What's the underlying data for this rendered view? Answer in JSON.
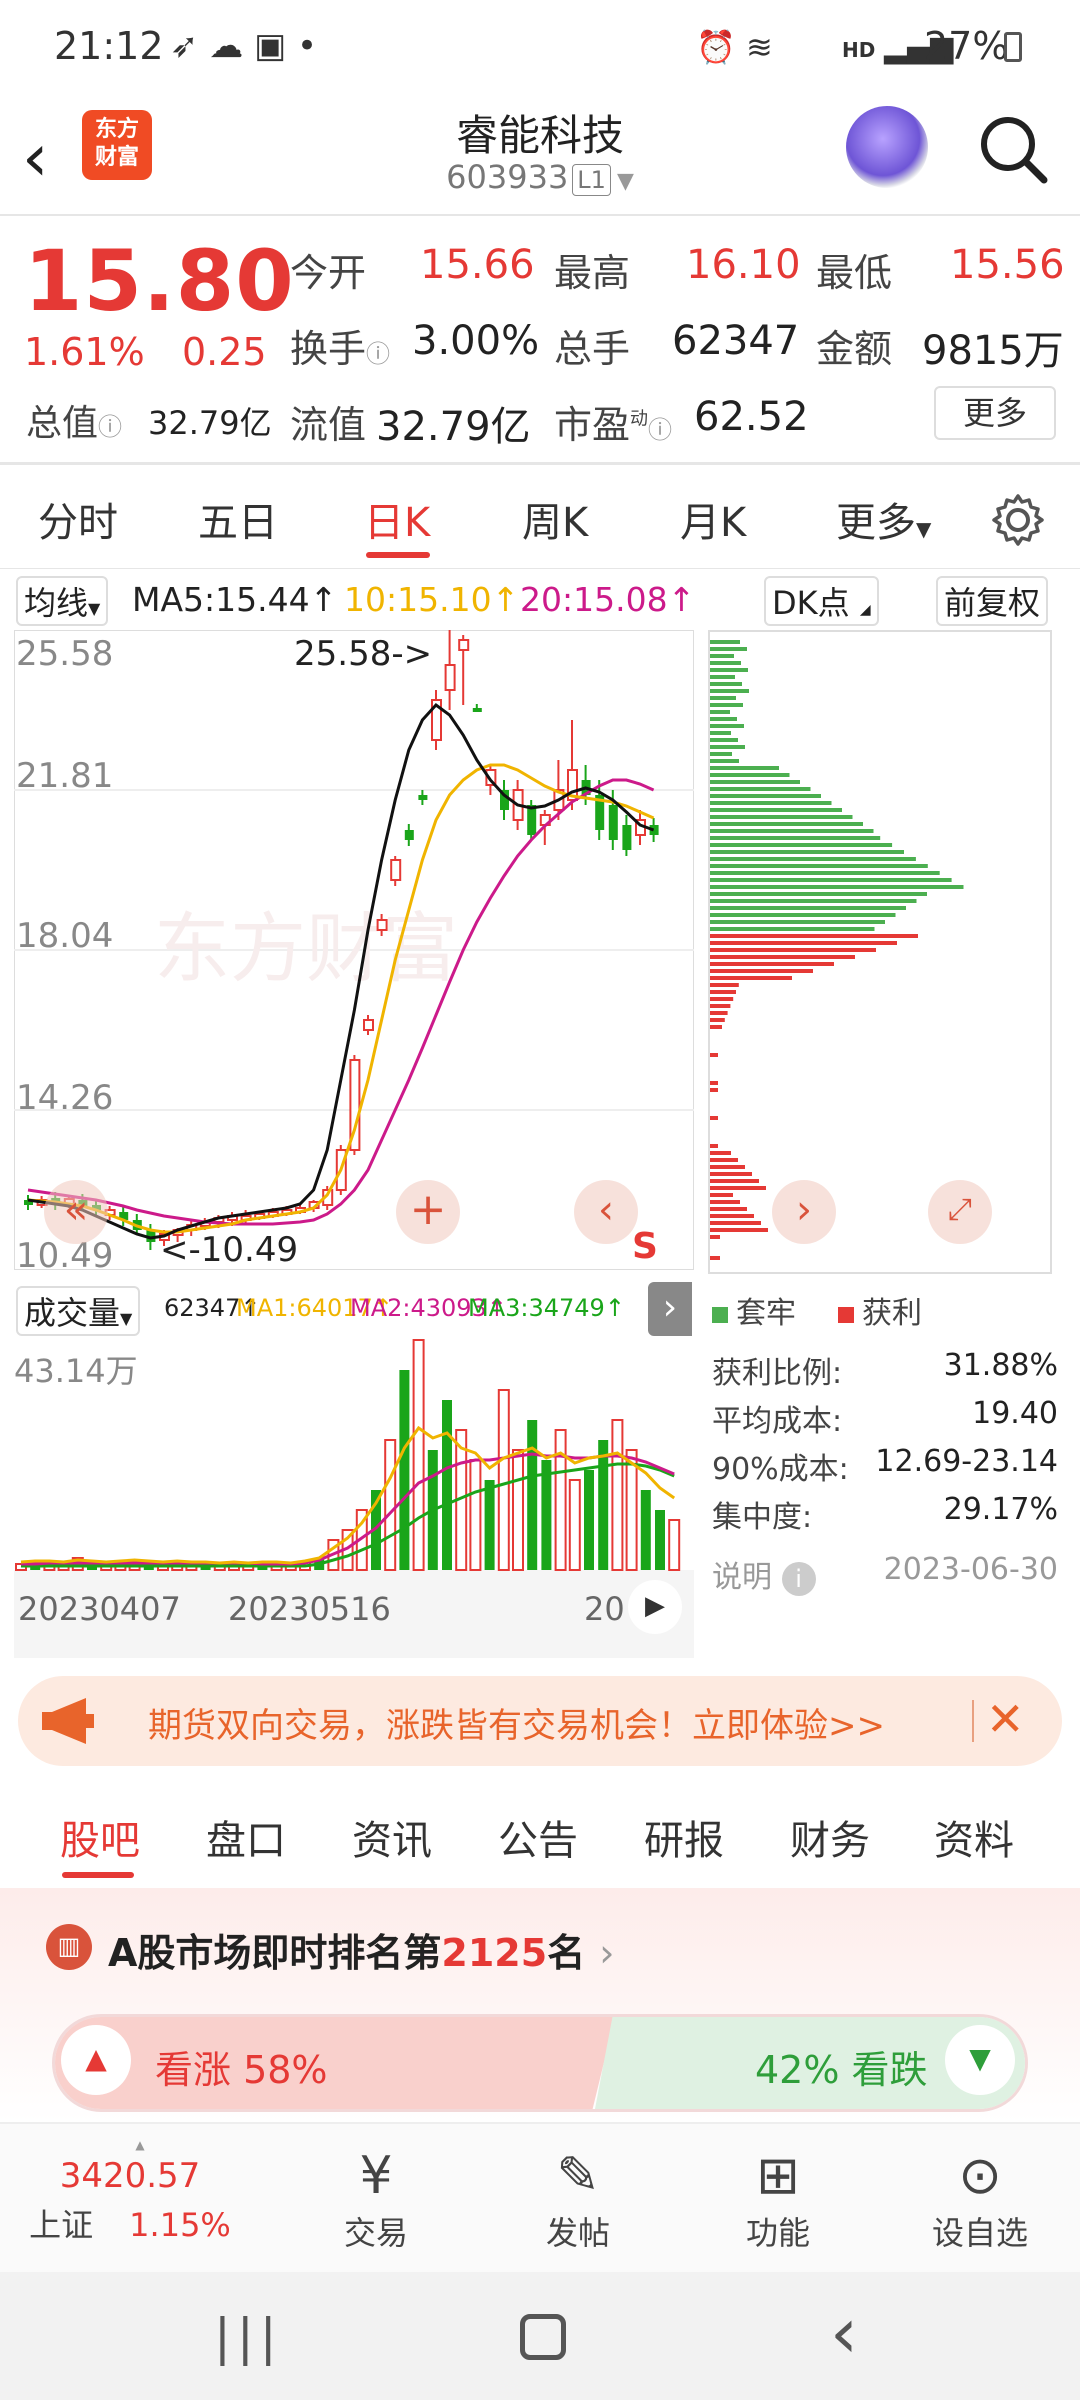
{
  "status_bar": {
    "time": "21:12",
    "hd": "HD",
    "battery": "27%"
  },
  "header": {
    "logo_line1": "东方",
    "logo_line2": "财富",
    "title": "睿能科技",
    "code": "603933",
    "level_badge": "L1"
  },
  "quote": {
    "price": "15.80",
    "pct_change": "1.61%",
    "change": "0.25",
    "row1": [
      {
        "label": "今开",
        "value": "15.66"
      },
      {
        "label": "最高",
        "value": "16.10"
      },
      {
        "label": "最低",
        "value": "15.56"
      }
    ],
    "row2": [
      {
        "label": "换手",
        "value": "3.00%"
      },
      {
        "label": "总手",
        "value": "62347"
      },
      {
        "label": "金额",
        "value": "9815万"
      }
    ],
    "row3": [
      {
        "label": "总值",
        "value": "32.79亿"
      },
      {
        "label": "流值",
        "value": "32.79亿"
      },
      {
        "label": "市盈",
        "sup": "动",
        "value": "62.52"
      }
    ],
    "more": "更多"
  },
  "tabs": [
    "分时",
    "五日",
    "日K",
    "周K",
    "月K",
    "更多"
  ],
  "ma": {
    "selector": "均线",
    "ma5": "MA5:15.44",
    "ma10": "10:15.10",
    "ma20": "20:15.08",
    "dk": "DK点",
    "adjust": "前复权"
  },
  "chart": {
    "y_labels": [
      "25.58",
      "21.81",
      "18.04",
      "14.26",
      "10.49"
    ],
    "high_marker": "25.58->",
    "low_marker": "<-10.49",
    "s_marker": "S",
    "colors": {
      "up": "#e53935",
      "down": "#1aa51a",
      "ma5": "#111111",
      "ma10": "#f0b400",
      "ma20": "#cc1a8a"
    }
  },
  "volume": {
    "selector": "成交量",
    "vol": "62347",
    "ma1": "MA1:64017",
    "ma2": "MA2:43093",
    "ma3": "MA3:34749",
    "y_label": "43.14万",
    "dates": [
      "20230407",
      "20230516",
      "20"
    ]
  },
  "chip": {
    "legend_locked": "套牢",
    "legend_profit": "获利",
    "stats": [
      {
        "label": "获利比例:",
        "value": "31.88%"
      },
      {
        "label": "平均成本:",
        "value": "19.40"
      },
      {
        "label": "90%成本:",
        "value": "12.69-23.14"
      },
      {
        "label": "集中度:",
        "value": "29.17%"
      }
    ],
    "note_label": "说明",
    "date": "2023-06-30"
  },
  "banner": {
    "text": "期货双向交易，涨跌皆有交易机会！立即体验>>"
  },
  "bottom_tabs": [
    "股吧",
    "盘口",
    "资讯",
    "公告",
    "研报",
    "财务",
    "资料"
  ],
  "ranking": {
    "prefix": "A股市场即时排名第",
    "rank": "2125",
    "suffix": "名"
  },
  "vote": {
    "up": "看涨 58%",
    "down": "42% 看跌"
  },
  "bottom_nav": {
    "index_value": "3420.57",
    "index_name": "上证",
    "index_pct": "1.15%",
    "trade": "交易",
    "post": "发帖",
    "func": "功能",
    "watch": "设自选"
  }
}
